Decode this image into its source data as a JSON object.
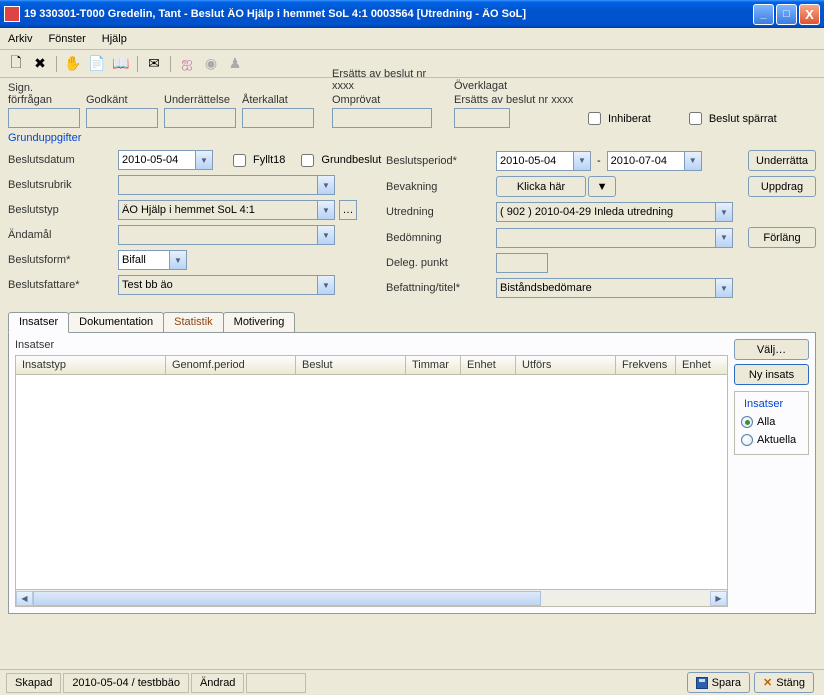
{
  "title": "19 330301-T000  Gredelin, Tant   -   Beslut   ÄO Hjälp i hemmet SoL 4:1   0003564   [Utredning - ÄO SoL]",
  "menu": {
    "arkiv": "Arkiv",
    "fonster": "Fönster",
    "hjalp": "Hjälp"
  },
  "top_labels": {
    "sign": "Sign. förfrågan",
    "godkant": "Godkänt",
    "underrattelse": "Underrättelse",
    "aterkallat": "Återkallat",
    "omprovat": "Omprövat",
    "ersatts1": "Ersätts av beslut nr xxxx",
    "overklagat": "Överklagat",
    "ersatts2": "Ersätts av beslut nr xxxx",
    "inhiberat": "Inhiberat",
    "sparrat": "Beslut spärrat"
  },
  "section_title": "Grunduppgifter",
  "labels": {
    "beslutsdatum": "Beslutsdatum",
    "fyllt18": "Fyllt18",
    "grundbeslut": "Grundbeslut",
    "beslutsperiod": "Beslutsperiod*",
    "beslutsrubrik": "Beslutsrubrik",
    "bevakning": "Bevakning",
    "beslutstyp": "Beslutstyp",
    "utredning": "Utredning",
    "andamal": "Ändamål",
    "bedomning": "Bedömning",
    "beslutsform": "Beslutsform*",
    "delegpunkt": "Deleg. punkt",
    "beslutsfattare": "Beslutsfattare*",
    "befattning": "Befattning/titel*"
  },
  "values": {
    "beslutsdatum": "2010-05-04",
    "period_from": "2010-05-04",
    "period_sep": "-",
    "period_to": "2010-07-04",
    "beslutstyp": "ÄO Hjälp i hemmet SoL 4:1",
    "utredning": "( 902 ) 2010-04-29 Inleda utredning",
    "beslutsform": "Bifall",
    "beslutsfattare": "Test bb äo",
    "befattning": "Biståndsbedömare",
    "klicka_har": "Klicka här"
  },
  "buttons": {
    "underratta": "Underrätta",
    "uppdrag": "Uppdrag",
    "forlang": "Förläng",
    "valj": "Välj…",
    "ny_insats": "Ny insats",
    "spara": "Spara",
    "stang": "Stäng"
  },
  "tabs": {
    "insatser": "Insatser",
    "dokumentation": "Dokumentation",
    "statistik": "Statistik",
    "motivering": "Motivering"
  },
  "table": {
    "title": "Insatser",
    "cols": {
      "insatstyp": "Insatstyp",
      "genomf": "Genomf.period",
      "beslut": "Beslut",
      "timmar": "Timmar",
      "enhet": "Enhet",
      "utfors": "Utförs",
      "frekvens": "Frekvens",
      "enhet2": "Enhet"
    }
  },
  "side": {
    "fieldset": "Insatser",
    "alla": "Alla",
    "aktuella": "Aktuella"
  },
  "status": {
    "skapad": "Skapad",
    "skapad_val": "2010-05-04 / testbbäo",
    "andrad": "Ändrad"
  }
}
